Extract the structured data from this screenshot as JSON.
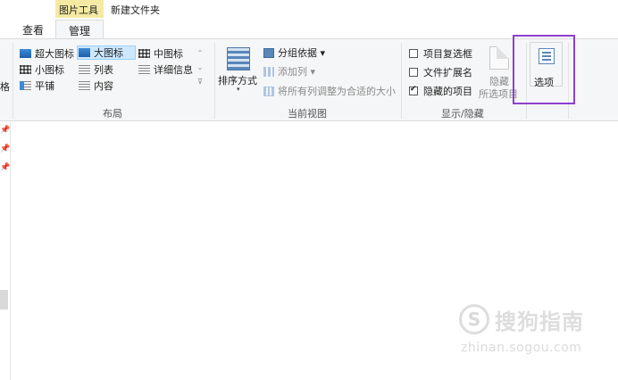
{
  "tabbar": {
    "context_tab": "图片工具",
    "title": "新建文件夹",
    "tabs": [
      {
        "label": "查看"
      },
      {
        "label": "管理"
      }
    ]
  },
  "ribbon": {
    "left_sliver_label": "格",
    "layout": {
      "label": "布局",
      "items": [
        {
          "label": "超大图标",
          "icon": "extra-large-icons-icon"
        },
        {
          "label": "大图标",
          "icon": "large-icons-icon",
          "selected": true
        },
        {
          "label": "中图标",
          "icon": "medium-icons-icon"
        },
        {
          "label": "小图标",
          "icon": "small-icons-icon"
        },
        {
          "label": "列表",
          "icon": "list-icon"
        },
        {
          "label": "详细信息",
          "icon": "details-icon"
        },
        {
          "label": "平铺",
          "icon": "tiles-icon"
        },
        {
          "label": "内容",
          "icon": "content-icon"
        }
      ],
      "scroll_glyphs": [
        "⌃",
        "⌄",
        "⊽"
      ]
    },
    "current_view": {
      "label": "当前视图",
      "sort_by": "排序方式",
      "sort_caret": "▾",
      "group_by": "分组依据 ▾",
      "add_columns": "添加列 ▾",
      "size_columns": "将所有列调整为合适的大小"
    },
    "show_hide": {
      "label": "显示/隐藏",
      "item_check_boxes": {
        "label": "项目复选框",
        "checked": false
      },
      "file_name_extensions": {
        "label": "文件扩展名",
        "checked": false
      },
      "hidden_items": {
        "label": "隐藏的项目",
        "checked": true
      },
      "hide_selected_line1": "隐藏",
      "hide_selected_line2": "所选项目"
    },
    "options": {
      "label": "选项"
    }
  },
  "watermark": {
    "logo_glyph": "S",
    "text": "搜狗指南",
    "url": "zhinan.sogou.com"
  },
  "colors": {
    "context_tab_bg": "#f4eaa3",
    "ribbon_bg": "#f5f6f7",
    "selected_bg": "#cce8ff",
    "highlight_border": "#8e3fcf"
  }
}
